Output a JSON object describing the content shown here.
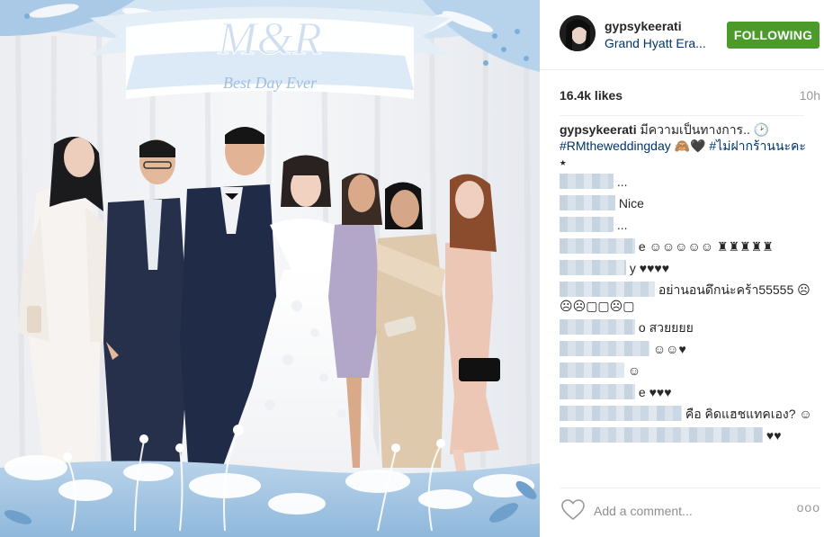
{
  "post": {
    "username": "gypsykeerati",
    "location": "Grand Hyatt Era...",
    "follow_label": "FOLLOWING",
    "likes": "16.4k likes",
    "time": "10h",
    "caption": {
      "user": "gypsykeerati",
      "text": " มีความเป็นทางการ.. 🕑",
      "hashtag1": "#RMtheweddingday",
      "mid": " 🙈🖤 ",
      "hashtag2": "#ไม่ฝากร้านนะคะ",
      "end": " ⭑"
    },
    "comments": [
      {
        "text": "..."
      },
      {
        "text": "Nice"
      },
      {
        "text": "..."
      },
      {
        "text": "e ☺☺☺☺☺ ♜♜♜♜♜"
      },
      {
        "text": "y ♥♥♥♥"
      },
      {
        "text": "อย่านอนดึกน่ะคร้า55555 ☹☹☹▢▢☹▢"
      },
      {
        "text": "o สวยยยย"
      },
      {
        "text": "☺☺♥"
      },
      {
        "text": "☺"
      },
      {
        "text": "e ♥♥♥"
      },
      {
        "text": "คือ คิดแฮชแทคเอง? ☺"
      },
      {
        "text": "♥♥"
      }
    ],
    "add_comment_placeholder": "Add a comment...",
    "more_label": "ooo"
  },
  "photo": {
    "banner_monogram": "M&R",
    "banner_text": "Best Day Ever"
  },
  "colors": {
    "follow_green": "#4c9a2a",
    "link_blue": "#003569"
  }
}
